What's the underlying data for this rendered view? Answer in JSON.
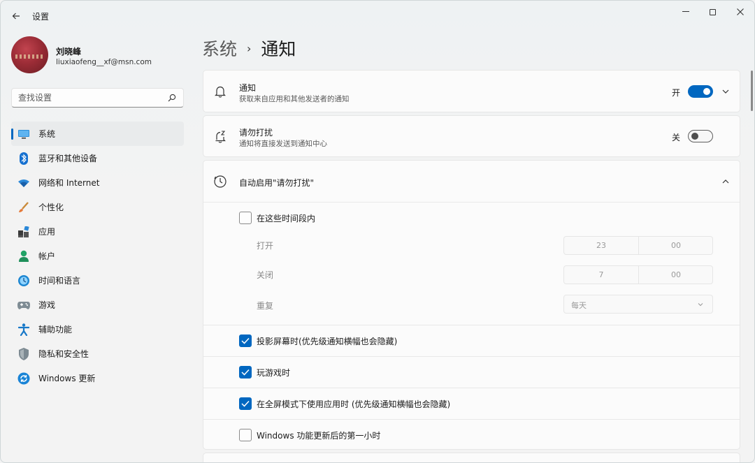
{
  "window": {
    "title": "设置",
    "controls": {
      "minimize": "—",
      "close": "✕"
    }
  },
  "profile": {
    "name": "刘晓峰",
    "email": "liuxiaofeng__xf@msn.com"
  },
  "search": {
    "placeholder": "查找设置"
  },
  "sidebar": {
    "items": [
      {
        "label": "系统",
        "icon": "system-icon",
        "active": true
      },
      {
        "label": "蓝牙和其他设备",
        "icon": "bluetooth-icon"
      },
      {
        "label": "网络和 Internet",
        "icon": "wifi-icon"
      },
      {
        "label": "个性化",
        "icon": "brush-icon"
      },
      {
        "label": "应用",
        "icon": "apps-icon"
      },
      {
        "label": "帐户",
        "icon": "account-icon"
      },
      {
        "label": "时间和语言",
        "icon": "globe-clock-icon"
      },
      {
        "label": "游戏",
        "icon": "gamepad-icon"
      },
      {
        "label": "辅助功能",
        "icon": "accessibility-icon"
      },
      {
        "label": "隐私和安全性",
        "icon": "shield-icon"
      },
      {
        "label": "Windows 更新",
        "icon": "update-icon"
      }
    ]
  },
  "breadcrumb": {
    "parent": "系统",
    "separator": "›",
    "current": "通知"
  },
  "notifications": {
    "title": "通知",
    "description": "获取来自应用和其他发送者的通知",
    "toggle_label": "开",
    "enabled": true
  },
  "dnd": {
    "title": "请勿打扰",
    "description": "通知将直接发送到通知中心",
    "toggle_label": "关",
    "enabled": false
  },
  "auto_dnd": {
    "title": "自动启用\"请勿打扰\"",
    "time_range": {
      "label": "在这些时间段内",
      "checked": false,
      "on_label": "打开",
      "on_hour": "23",
      "on_minute": "00",
      "off_label": "关闭",
      "off_hour": "7",
      "off_minute": "00",
      "repeat_label": "重复",
      "repeat_value": "每天"
    },
    "options": [
      {
        "label": "投影屏幕时(优先级通知横幅也会隐藏)",
        "checked": true
      },
      {
        "label": "玩游戏时",
        "checked": true
      },
      {
        "label": "在全屏模式下使用应用时 (优先级通知横幅也会隐藏)",
        "checked": true
      },
      {
        "label": "Windows 功能更新后的第一小时",
        "checked": false
      }
    ]
  },
  "colors": {
    "accent": "#0067c0",
    "background": "#f3f3f3",
    "card": "#fbfbfb"
  }
}
